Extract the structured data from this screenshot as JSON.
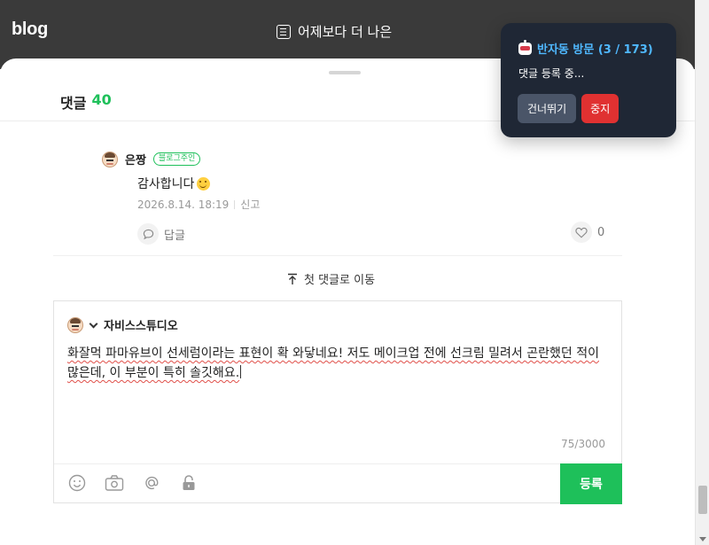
{
  "blog_header": {
    "logo": "blog",
    "title": "어제보다 더 나은"
  },
  "comments_sheet": {
    "heading": "댓글",
    "count": "40",
    "comment": {
      "author": "은짱",
      "badge": "블로그주인",
      "text": "감사합니다",
      "emoji": "smile",
      "date": "2026.8.14. 18:19",
      "report": "신고",
      "reply": "답글",
      "likes": "0"
    },
    "first_comment_link": "첫 댓글로 이동",
    "write": {
      "author": "자비스스튜디오",
      "text": "화잘먹 파마유브이 선세럼이라는 표현이 확 와닿네요! 저도 메이크업 전에 선크림 밀려서 곤란했던 적이 많은데, 이 부분이 특히 솔깃해요.",
      "char_count": "75/3000",
      "submit": "등록",
      "tools": [
        "emoji-icon",
        "camera-icon",
        "mention-icon",
        "lock-icon"
      ]
    }
  },
  "popup": {
    "title": "반자동 방문 (3 / 173)",
    "status": "댓글 등록 중...",
    "skip": "건너뛰기",
    "stop": "중지",
    "colors": {
      "bg": "#1f2735",
      "title": "#4fb8ff",
      "stop": "#e03131"
    }
  },
  "colors": {
    "accent": "#1ec05a",
    "header": "#3a3a3a"
  }
}
